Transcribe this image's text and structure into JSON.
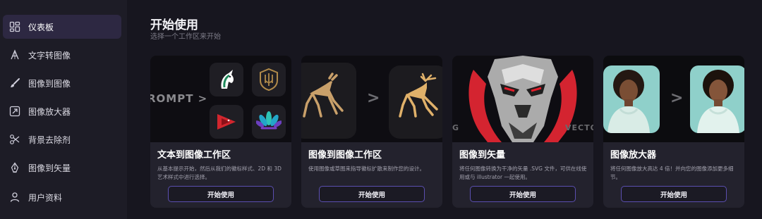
{
  "sidebar": {
    "items": [
      {
        "label": "仪表板",
        "icon": "dashboard-icon",
        "active": true
      },
      {
        "label": "文字转图像",
        "icon": "text-a-icon",
        "active": false
      },
      {
        "label": "图像到图像",
        "icon": "brush-icon",
        "active": false
      },
      {
        "label": "图像放大器",
        "icon": "expand-icon",
        "active": false
      },
      {
        "label": "背景去除剂",
        "icon": "scissors-icon",
        "active": false
      },
      {
        "label": "图像到矢量",
        "icon": "pen-nib-icon",
        "active": false
      },
      {
        "label": "用户资料",
        "icon": "user-icon",
        "active": false
      }
    ]
  },
  "main": {
    "title": "开始使用",
    "subtitle": "选择一个工作区来开始",
    "cards": [
      {
        "title": "文本到图像工作区",
        "description": "从基本提示开始，然后从我们的徽标样式、2D 和 3D 艺术样式中进行选择。",
        "button": "开始使用",
        "image_text": "ROMPT >"
      },
      {
        "title": "图像到图像工作区",
        "description": "使用图像或草图来指导徽标扩散来制作您的设计。",
        "button": "开始使用",
        "image_text": ">"
      },
      {
        "title": "图像到矢量",
        "description": "将任何图像转换为干净的矢量 .SVG 文件，可供在线使用或与 illustrator 一起使用。",
        "button": "开始使用",
        "image_text_left": "G",
        "image_text_right": "VECTO"
      },
      {
        "title": "图像放大器",
        "description": "将任何图像放大高达 4 倍！并向您的图像添加更多细节。",
        "button": "开始使用",
        "image_text": ">"
      }
    ]
  },
  "colors": {
    "background": "#17161f",
    "sidebar": "#1d1c26",
    "active_item": "#2d2842",
    "card": "#23222d",
    "button_border": "#5b4fb0"
  }
}
